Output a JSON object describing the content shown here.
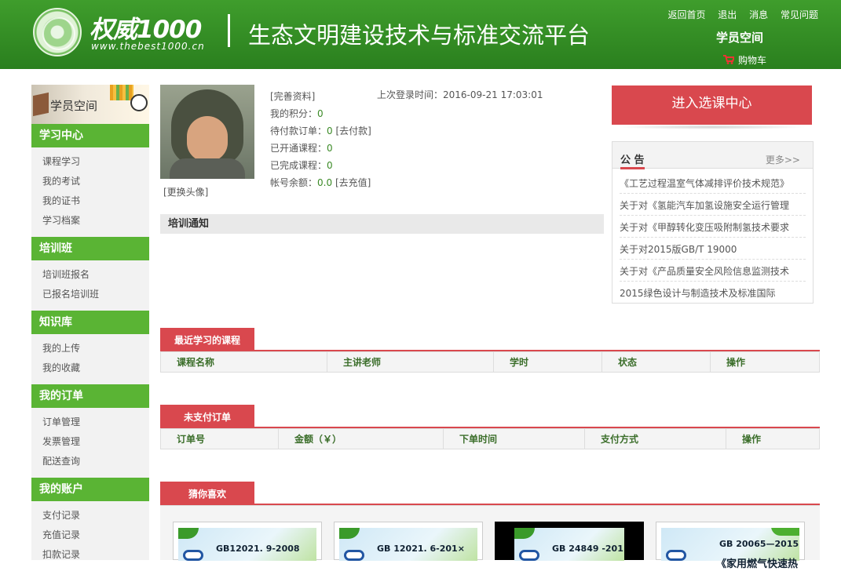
{
  "header": {
    "logo_title": "权威1000",
    "logo_url": "www.thebest1000.cn",
    "platform": "生态文明建设技术与标准交流平台",
    "links": [
      "返回首页",
      "退出",
      "消息",
      "常见问题"
    ],
    "student_space": "学员空间",
    "cart": "购物车"
  },
  "sidebar": {
    "banner": "学员空间",
    "groups": [
      {
        "title": "学习中心",
        "items": [
          "课程学习",
          "我的考试",
          "我的证书",
          "学习档案"
        ]
      },
      {
        "title": "培训班",
        "items": [
          "培训班报名",
          "已报名培训班"
        ]
      },
      {
        "title": "知识库",
        "items": [
          "我的上传",
          "我的收藏"
        ]
      },
      {
        "title": "我的订单",
        "items": [
          "订单管理",
          "发票管理",
          "配送查询"
        ]
      },
      {
        "title": "我的账户",
        "items": [
          "支付记录",
          "充值记录",
          "扣款记录"
        ]
      }
    ]
  },
  "profile": {
    "change_avatar": "[更换头像]",
    "complete": "[完善资料]",
    "last_login_label": "上次登录时间：",
    "last_login": "2016-09-21 17:03:01",
    "points_label": "我的积分：",
    "points": "0",
    "pending_label": "待付款订单：",
    "pending": "0",
    "pending_link": "[去付款]",
    "opened_label": "已开通课程：",
    "opened": "0",
    "done_label": "已完成课程：",
    "done": "0",
    "balance_label": "帐号余额：",
    "balance": "0.0",
    "recharge_link": "[去充值]"
  },
  "training_notice": "培训通知",
  "enter_button": "进入选课中心",
  "notice": {
    "title": "公 告",
    "more": "更多>>",
    "items": [
      "《工艺过程温室气体减排评价技术规范》",
      "关于对《氢能汽车加氢设施安全运行管理",
      "关于对《甲醇转化变压吸附制氢技术要求",
      "关于对2015版GB/T 19000",
      "关于对《产品质量安全风险信息监测技术",
      "2015绿色设计与制造技术及标准国际"
    ]
  },
  "recent_courses": {
    "tab": "最近学习的课程",
    "columns": [
      "课程名称",
      "主讲老师",
      "学时",
      "状态",
      "操作"
    ]
  },
  "unpaid_orders": {
    "tab": "未支付订单",
    "columns": [
      "订单号",
      "金额（￥）",
      "下单时间",
      "支付方式",
      "操作"
    ]
  },
  "guess": {
    "tab": "猜你喜欢",
    "cards": [
      {
        "code": "GB12021. 9-2008"
      },
      {
        "code": "GB 12021. 6-201×"
      },
      {
        "code": "GB 24849 -201×"
      },
      {
        "code": "GB 20065—2015",
        "sub": "《家用燃气快速热"
      }
    ]
  },
  "colors": {
    "green": "#3f9d2c",
    "side_green": "#5ab434",
    "red": "#d9484e"
  }
}
